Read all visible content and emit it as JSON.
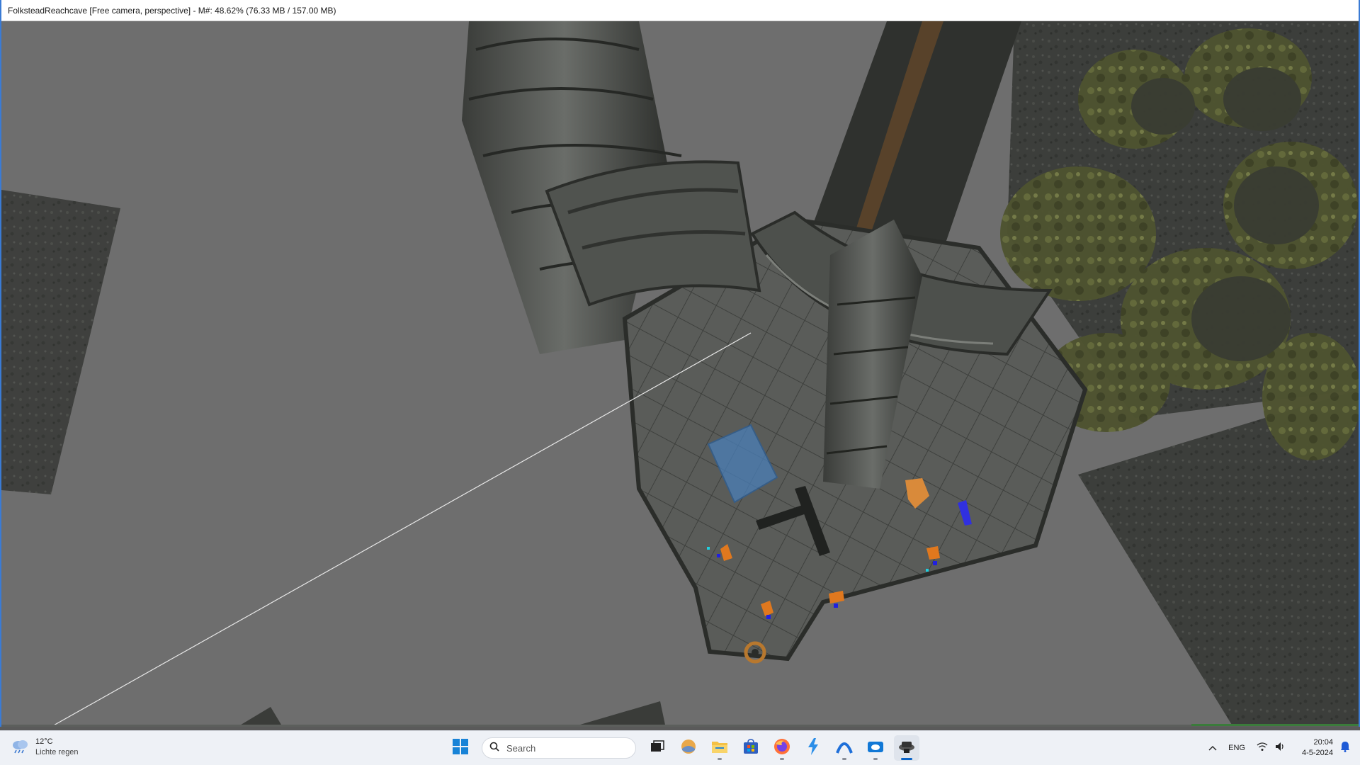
{
  "window": {
    "title": "FolksteadReachcave [Free camera, perspective] - M#: 48.62% (76.33 MB / 157.00 MB)"
  },
  "taskbar": {
    "weather": {
      "temperature": "12°C",
      "condition": "Lichte regen",
      "icon": "cloud-rain-icon"
    },
    "search": {
      "placeholder": "Search"
    },
    "apps": [
      {
        "name": "start",
        "icon": "windows-logo-icon"
      },
      {
        "name": "task-view",
        "icon": "task-view-icon"
      },
      {
        "name": "widgets",
        "icon": "widgets-icon"
      },
      {
        "name": "file-explorer",
        "icon": "folder-icon"
      },
      {
        "name": "microsoft-store",
        "icon": "store-icon"
      },
      {
        "name": "firefox",
        "icon": "firefox-icon"
      },
      {
        "name": "app-bolt",
        "icon": "bolt-icon"
      },
      {
        "name": "app-arc",
        "icon": "arc-icon"
      },
      {
        "name": "app-cloud",
        "icon": "cloud-folder-icon"
      },
      {
        "name": "creation-kit",
        "icon": "creation-kit-icon"
      }
    ],
    "tray": {
      "chevron": "chevron-up-icon",
      "language": "ENG",
      "wifi": "wifi-icon",
      "volume": "volume-icon",
      "time": "20:04",
      "date": "4-5-2024",
      "notifications": "bell-icon"
    }
  },
  "colors": {
    "viewport_bg": "#6e6e6e",
    "stone_dark": "#3b3d3a",
    "stone_mid": "#575a56",
    "moss": "#5d6238",
    "selection_blue": "#4a7fb8",
    "marker_orange": "#e0781e",
    "accent_blue": "#0a64c8"
  }
}
